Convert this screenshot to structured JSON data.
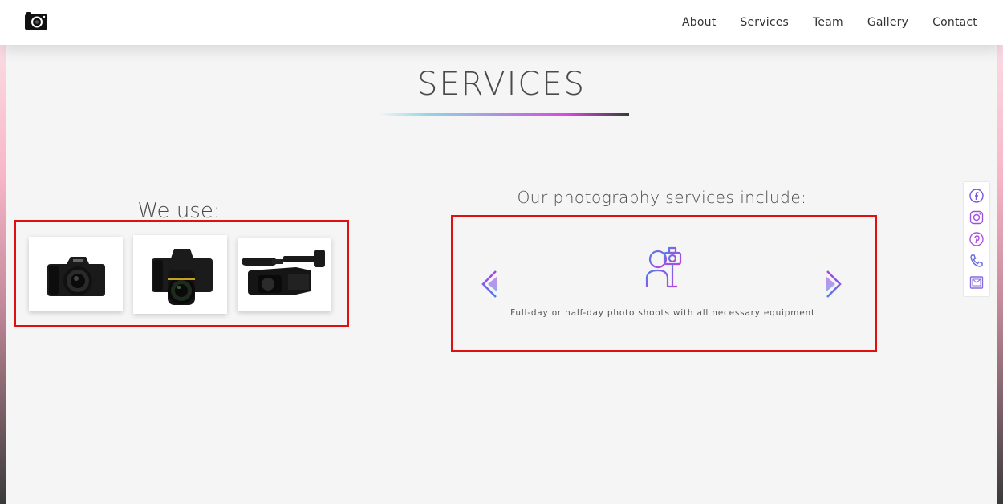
{
  "nav": {
    "logo_icon": "camera-icon",
    "links": [
      {
        "label": "About"
      },
      {
        "label": "Services"
      },
      {
        "label": "Team"
      },
      {
        "label": "Gallery"
      },
      {
        "label": "Contact"
      }
    ]
  },
  "section": {
    "title": "SERVICES"
  },
  "equipment": {
    "heading": "We use:",
    "items": [
      {
        "icon": "dslr-camera-icon"
      },
      {
        "icon": "mirrorless-camera-icon"
      },
      {
        "icon": "video-camcorder-icon"
      }
    ]
  },
  "services": {
    "heading": "Our photography services include:",
    "current_icon": "photographer-icon",
    "current_text": "Full-day or half-day photo shoots with all necessary equipment",
    "prev_icon": "chevron-double-left-icon",
    "next_icon": "chevron-double-right-icon"
  },
  "social": {
    "icons": [
      "facebook-icon",
      "instagram-icon",
      "pinterest-icon",
      "phone-icon",
      "email-icon"
    ]
  },
  "colors": {
    "highlight": "#e01010",
    "accent_gradient_start": "#8fd6e6",
    "accent_gradient_mid": "#d64be0",
    "icon_purple": "#b040e0",
    "icon_blue": "#4f7de8"
  }
}
